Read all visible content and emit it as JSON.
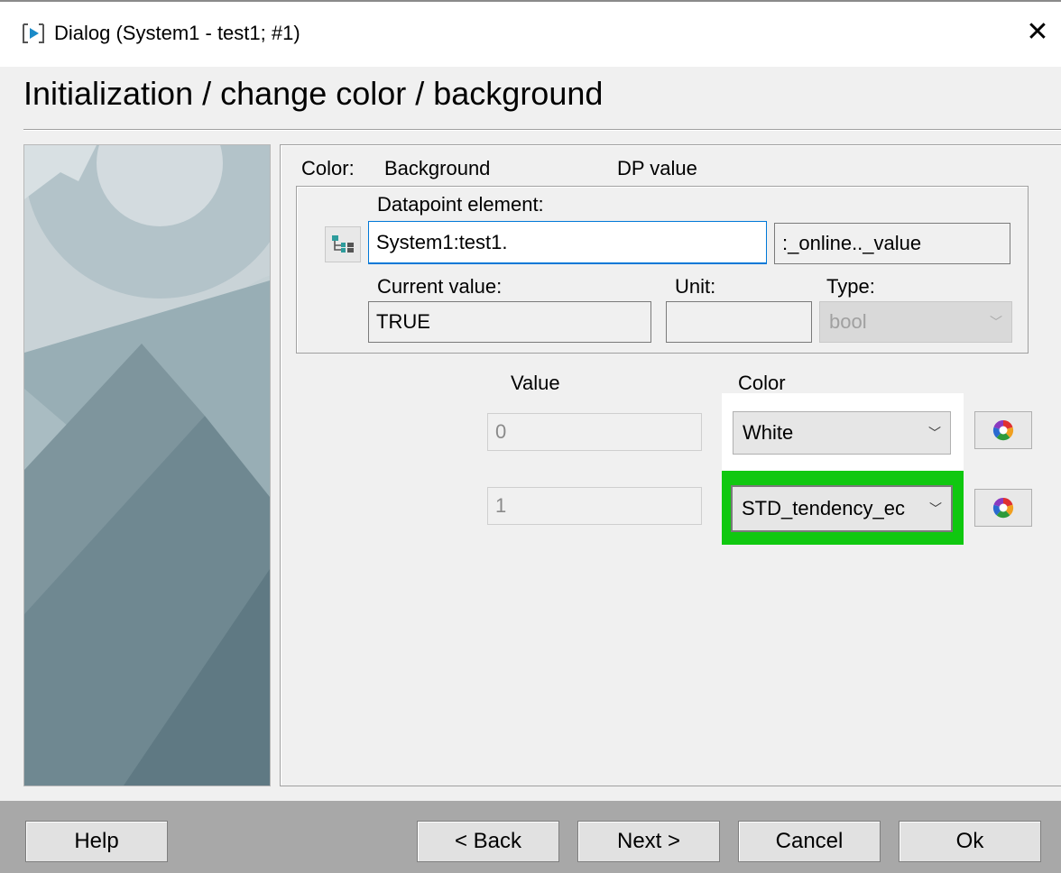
{
  "window": {
    "title": "Dialog (System1 - test1; #1)",
    "close_symbol": "✕",
    "app_icon": "play-dialog-icon"
  },
  "heading": "Initialization / change color / background",
  "form": {
    "color_label": "Color:",
    "color_target": "Background",
    "color_source": "DP value",
    "datapoint_label": "Datapoint element:",
    "datapoint_value": "System1:test1.",
    "datapoint_icon": "datapoint-tree-icon",
    "config_value": ":_online.._value",
    "current_value_label": "Current value:",
    "current_value": "TRUE",
    "unit_label": "Unit:",
    "unit_value": "",
    "type_label": "Type:",
    "type_value": "bool"
  },
  "table": {
    "value_header": "Value",
    "color_header": "Color",
    "rows": [
      {
        "value": "0",
        "color": "White"
      },
      {
        "value": "1",
        "color": "STD_tendency_ec"
      }
    ],
    "palette_icon": "color-wheel-icon"
  },
  "buttons": {
    "help": "Help",
    "back": "< Back",
    "next": "Next >",
    "cancel": "Cancel",
    "ok": "Ok"
  },
  "colors": {
    "highlight": "#10c810",
    "focus": "#0078d7"
  }
}
